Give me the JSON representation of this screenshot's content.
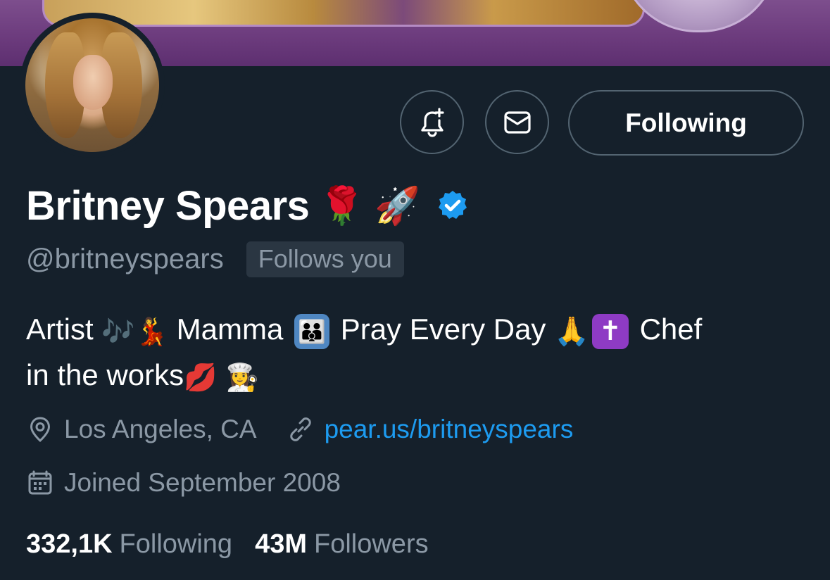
{
  "profile": {
    "name": "Britney Spears",
    "name_emojis": [
      "🌹",
      "🚀"
    ],
    "handle": "@britneyspears",
    "follows_you": "Follows you",
    "verified": true,
    "bio_parts": {
      "p1": "Artist",
      "e1": "🎶💃",
      "p2": "Mamma",
      "e2": "👪",
      "p3": "Pray Every Day",
      "e3": "🙏",
      "e4": "✝",
      "p4": "Chef",
      "p5": "in the works",
      "e5": "💋 👩‍🍳"
    },
    "location": "Los Angeles, CA",
    "website": "pear.us/britneyspears",
    "joined": "Joined September 2008"
  },
  "stats": {
    "following_count": "332,1K",
    "following_label": "Following",
    "followers_count": "43M",
    "followers_label": "Followers"
  },
  "actions": {
    "follow_label": "Following"
  },
  "icons": {
    "bell": "bell-plus-icon",
    "message": "envelope-icon",
    "location": "location-pin-icon",
    "link": "link-icon",
    "calendar": "calendar-icon",
    "verified": "verified-badge-icon"
  },
  "colors": {
    "background": "#15202b",
    "accent": "#1d9bf0",
    "secondary_text": "#8b98a5",
    "border": "#536471"
  }
}
